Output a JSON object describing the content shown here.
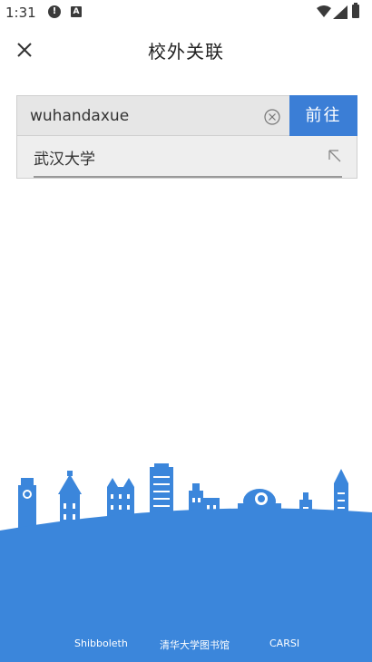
{
  "status": {
    "time": "1:31"
  },
  "header": {
    "title": "校外关联",
    "close_icon": "close-icon"
  },
  "search": {
    "value": "wuhandaxue",
    "go_label": "前往",
    "clear_icon": "clear-circle-icon"
  },
  "suggestions": [
    {
      "label": "武汉大学",
      "icon": "arrow-up-left-icon"
    }
  ],
  "footer": {
    "links": [
      "Shibboleth",
      "清华大学图书馆",
      "CARSI"
    ],
    "colors": {
      "wave": "#3b86db",
      "buildings": "#3b86db"
    }
  },
  "colors": {
    "accent": "#3b7ed6",
    "input_bg": "#e6e6e6"
  }
}
